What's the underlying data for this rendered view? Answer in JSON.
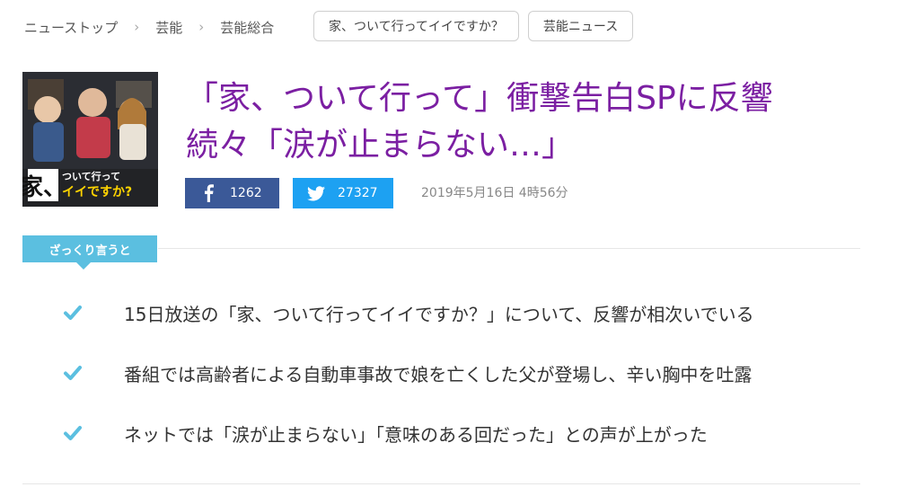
{
  "breadcrumb": [
    "ニューストップ",
    "芸能",
    "芸能総合"
  ],
  "tags": [
    "家、ついて行ってイイですか？",
    "芸能ニュース"
  ],
  "thumbnail": {
    "logo_lines": [
      "家、",
      "ついて行って",
      "イイですか?"
    ]
  },
  "article": {
    "title_line1": "「家、ついて行って」衝撃告白SPに反響",
    "title_line2": "続々「涙が止まらない…」",
    "date": "2019年5月16日 4時56分"
  },
  "share": {
    "facebook_count": "1262",
    "twitter_count": "27327"
  },
  "summary": {
    "label": "ざっくり言うと",
    "points": [
      "15日放送の「家、ついて行ってイイですか？」について、反響が相次いでいる",
      "番組では高齢者による自動車事故で娘を亡くした父が登場し、辛い胸中を吐露",
      "ネットでは「涙が止まらない」「意味のある回だった」との声が上がった"
    ]
  },
  "colors": {
    "title": "#7b1fa2",
    "facebook": "#3b5998",
    "twitter": "#1da1f2",
    "accent": "#5bbfe0"
  },
  "icons": [
    "chevron-right-icon",
    "facebook-icon",
    "twitter-icon",
    "check-icon"
  ]
}
